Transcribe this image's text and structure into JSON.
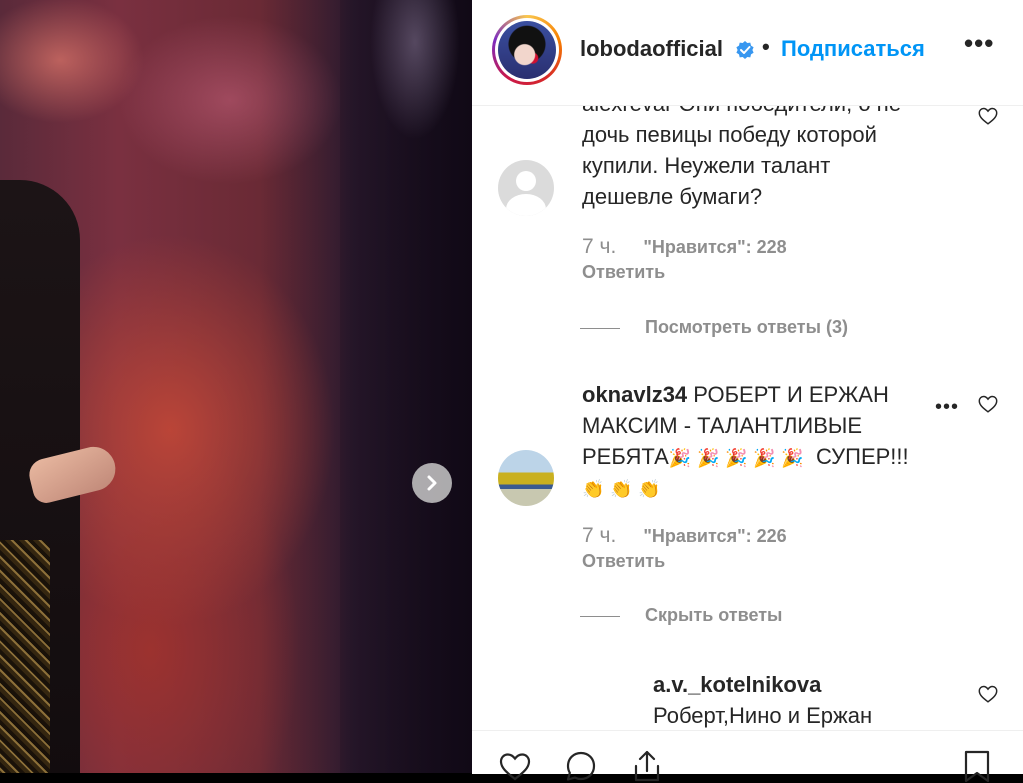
{
  "post": {
    "username": "lobodaofficial",
    "dot": "•",
    "follow_label": "Подписаться",
    "more_label": "•••"
  },
  "comments": [
    {
      "text_clipped": "alexrevar Они победители, о не",
      "lines": [
        "дочь певицы победу которой",
        "купили. Неужели талант",
        "дешевле бумаги?"
      ],
      "time": "7 ч.",
      "likes": "\"Нравится\": 228",
      "reply": "Ответить",
      "view_replies": "Посмотреть ответы (3)"
    },
    {
      "username": "oknavlz34",
      "line1": "РОБЕРТ И ЕРЖАН",
      "line2": "МАКСИМ - ТАЛАНТЛИВЫЕ",
      "line3_text": "РЕБЯТА",
      "party": "🎉 🎉 🎉 🎉 🎉",
      "line3_end": "СУПЕР!!!",
      "clap": "👏 👏 👏",
      "time": "7 ч.",
      "likes": "\"Нравится\": 226",
      "reply": "Ответить",
      "hide_replies": "Скрыть ответы",
      "more_label": "•••"
    }
  ],
  "reply_comment": {
    "username": "a.v._kotelnikova",
    "text": "Роберт,Нино и Ержан"
  },
  "icons": {
    "next": "chevron-right-icon",
    "verified": "verified-badge-icon",
    "heart": "heart-icon",
    "comment": "comment-icon",
    "share": "share-icon",
    "save": "bookmark-icon"
  },
  "colors": {
    "accent": "#0095f6",
    "text": "#262626",
    "muted": "#8e8e8e"
  }
}
